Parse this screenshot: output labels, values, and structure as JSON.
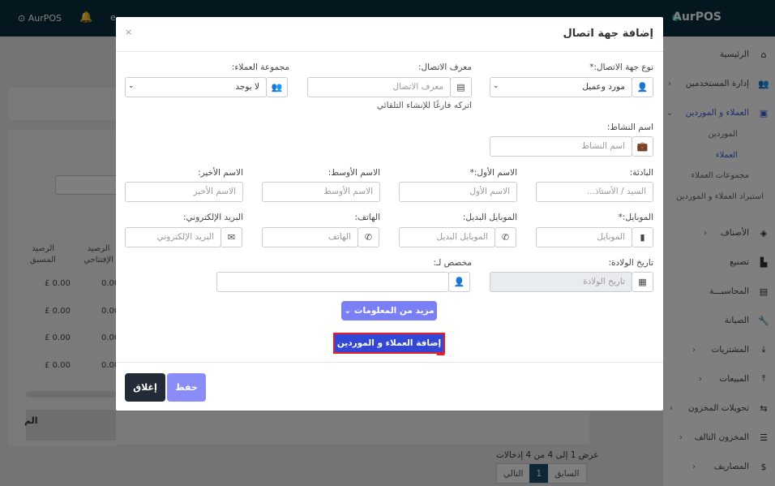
{
  "topbar": {
    "brand": "AurPOS",
    "user_brand": "AurPOS",
    "extra": "e"
  },
  "sidebar": {
    "items": [
      {
        "label": "الرئيسية",
        "icon": "⌂"
      },
      {
        "label": "إدارة المستخدمين",
        "icon": "👥"
      },
      {
        "label": "العملاء و الموردين",
        "icon": "▣"
      },
      {
        "label": "الأصناف",
        "icon": "◈"
      },
      {
        "label": "تصنيع",
        "icon": "▙"
      },
      {
        "label": "المحاسبـــة",
        "icon": "▤"
      },
      {
        "label": "الصيانة",
        "icon": "🔧"
      },
      {
        "label": "المشتريات",
        "icon": "⤓"
      },
      {
        "label": "المبيعات",
        "icon": "⤒"
      },
      {
        "label": "تحويلات المخزون",
        "icon": "⇆"
      },
      {
        "label": "المخزون التالف",
        "icon": "☰"
      },
      {
        "label": "المصاريف",
        "icon": "$"
      }
    ],
    "sub_items": [
      "الموردين",
      "العملاء",
      "مجموعات العملاء",
      "استيراد العملاء و الموردين"
    ]
  },
  "background": {
    "col_headers": [
      "الرصيد المسبق",
      "الرصيد الإفتتاحي"
    ],
    "rows": [
      {
        "prev": "£ 0.00",
        "open": "0.00"
      },
      {
        "prev": "£ 0.00",
        "open": "0.00"
      },
      {
        "prev": "£ 0.00",
        "open": "0.00"
      },
      {
        "prev": "£ 0.00",
        "open": "0.00"
      }
    ],
    "footer_label": "الم",
    "pagination_info": "عرض 1 إلى 4 من 4 إدخالات",
    "prev": "السابق",
    "page": "1",
    "next": "التالي"
  },
  "modal": {
    "title": "إضافة جهة اتصال",
    "close": "×",
    "contact_type_label": "نوع جهة الاتصال:*",
    "contact_type_value": "مورد وعميل",
    "contact_id_label": "معرف الاتصال:",
    "contact_id_placeholder": "معرف الاتصال",
    "contact_id_hint": "اتركه فارغًا للإنشاء التلقائي",
    "customer_group_label": "مجموعة العملاء:",
    "customer_group_value": "لا يوجد",
    "business_name_label": "اسم النشاط:",
    "business_name_placeholder": "اسم النشاط",
    "prefix_label": "البادئة:",
    "prefix_placeholder": "السيد / الأستاذ...",
    "first_name_label": "الاسم الأول:*",
    "first_name_placeholder": "الاسم الأول",
    "middle_name_label": "الاسم الأوسط:",
    "middle_name_placeholder": "الاسم الأوسط",
    "last_name_label": "الاسم الأخير:",
    "last_name_placeholder": "الاسم الأخير",
    "mobile_label": "الموبايل:*",
    "mobile_placeholder": "الموبايل",
    "alt_mobile_label": "الموبايل البديل:",
    "alt_mobile_placeholder": "الموبايل البديل",
    "phone_label": "الهاتف:",
    "phone_placeholder": "الهاتف",
    "email_label": "البريد الإلكتروني:",
    "email_placeholder": "البريد الإلكتروني",
    "dob_label": "تاريخ الولادة:",
    "dob_placeholder": "تاريخ الولادة",
    "assigned_label": "مخصص لـ:",
    "more_info": "مزيد من المعلومات",
    "add_customers": "إضافة العملاء و الموردين",
    "save": "حفظ",
    "close_btn": "إغلاق"
  }
}
